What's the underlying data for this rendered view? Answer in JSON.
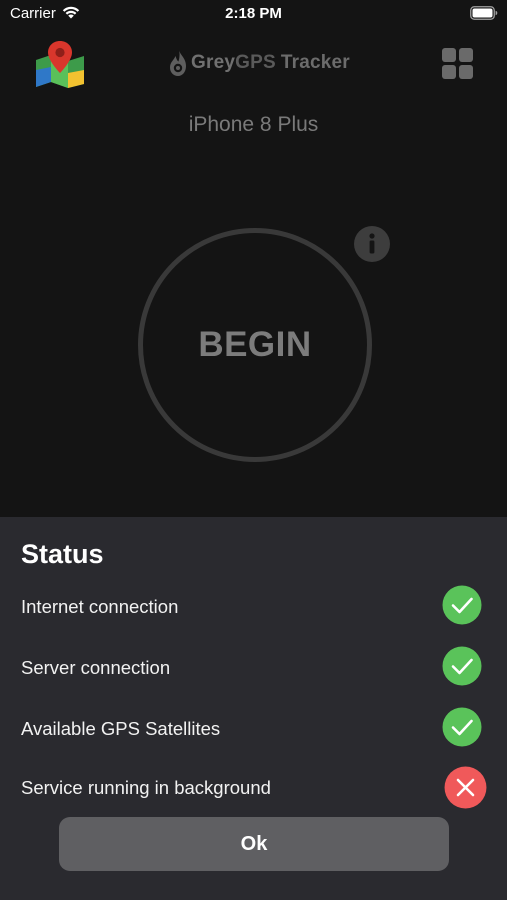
{
  "status_bar": {
    "carrier": "Carrier",
    "time": "2:18 PM"
  },
  "header": {
    "brand_grey": "Grey",
    "brand_gps": "GPS",
    "brand_tracker": "Tracker",
    "map_icon": "map-pin-icon",
    "menu_icon": "grid-menu-icon"
  },
  "device_name": "iPhone 8 Plus",
  "begin_button": {
    "label": "BEGIN",
    "info_icon": "info-icon"
  },
  "status_sheet": {
    "title": "Status",
    "items": [
      {
        "label": "Internet connection",
        "state": "ok",
        "color": "#5ac35a"
      },
      {
        "label": "Server connection",
        "state": "ok",
        "color": "#5ac35a"
      },
      {
        "label": "Available GPS Satellites",
        "state": "ok",
        "color": "#5ac35a"
      },
      {
        "label": "Service running in background",
        "state": "error",
        "color": "#f0595a"
      }
    ],
    "ok_label": "Ok"
  },
  "colors": {
    "background": "#141414",
    "sheet": "#2a2a2f",
    "success": "#5ac35a",
    "error": "#f0595a",
    "button": "#5f5f62"
  }
}
